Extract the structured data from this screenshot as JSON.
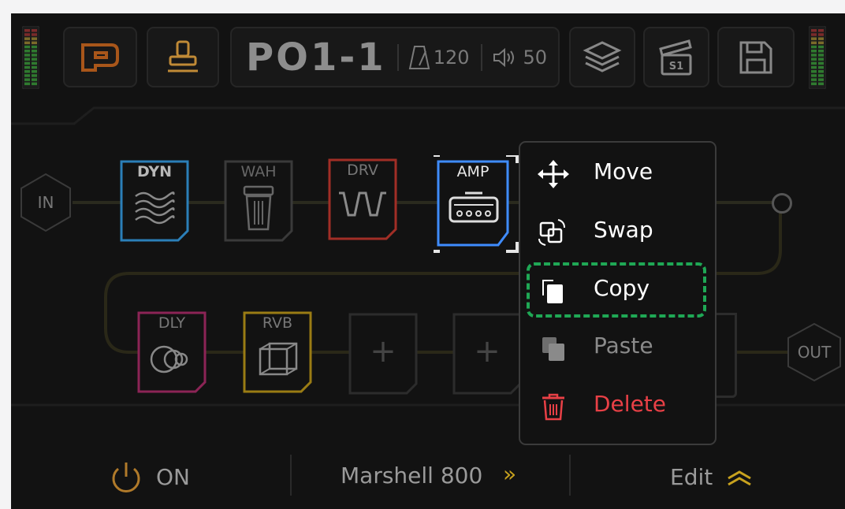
{
  "header": {
    "preset_id": "PO1-1",
    "tempo": "120",
    "volume": "50",
    "scene_badge": "S1",
    "icons": [
      "preset-logo-icon",
      "stamp-icon",
      "metronome-icon",
      "speaker-icon",
      "layers-icon",
      "clapperboard-icon",
      "save-icon"
    ]
  },
  "chain": {
    "input_label": "IN",
    "output_label": "OUT",
    "row1": [
      {
        "label": "DYN",
        "icon": "waves-icon",
        "color": "#2b7fb8"
      },
      {
        "label": "WAH",
        "icon": "wah-pedal-icon",
        "color": "#4a4a4a"
      },
      {
        "label": "DRV",
        "icon": "square-wave-icon",
        "color": "#b53228"
      },
      {
        "label": "AMP",
        "icon": "amp-icon",
        "color": "#3f8cff"
      }
    ],
    "row2": [
      {
        "label": "DLY",
        "icon": "delay-circles-icon",
        "color": "#a0265f"
      },
      {
        "label": "RVB",
        "icon": "reverb-cube-icon",
        "color": "#b39018"
      },
      {
        "label": "+",
        "icon": "add-icon"
      },
      {
        "label": "+",
        "icon": "add-icon"
      }
    ]
  },
  "context_menu": {
    "items": [
      {
        "label": "Move",
        "icon": "move-arrows-icon",
        "color": "#ffffff"
      },
      {
        "label": "Swap",
        "icon": "swap-icon",
        "color": "#ffffff"
      },
      {
        "label": "Copy",
        "icon": "copy-icon",
        "color": "#ffffff",
        "highlighted": true
      },
      {
        "label": "Paste",
        "icon": "paste-icon",
        "color": "#8a8a8a"
      },
      {
        "label": "Delete",
        "icon": "trash-icon",
        "color": "#e84046"
      }
    ],
    "highlight_color": "#1fa855"
  },
  "footer": {
    "power_label": "ON",
    "model_name": "Marshell 800",
    "model_chevron": "»",
    "edit_label": "Edit"
  },
  "colors": {
    "background": "#121212",
    "accent_orange": "#c86a1c",
    "accent_gold": "#b98a2e"
  }
}
